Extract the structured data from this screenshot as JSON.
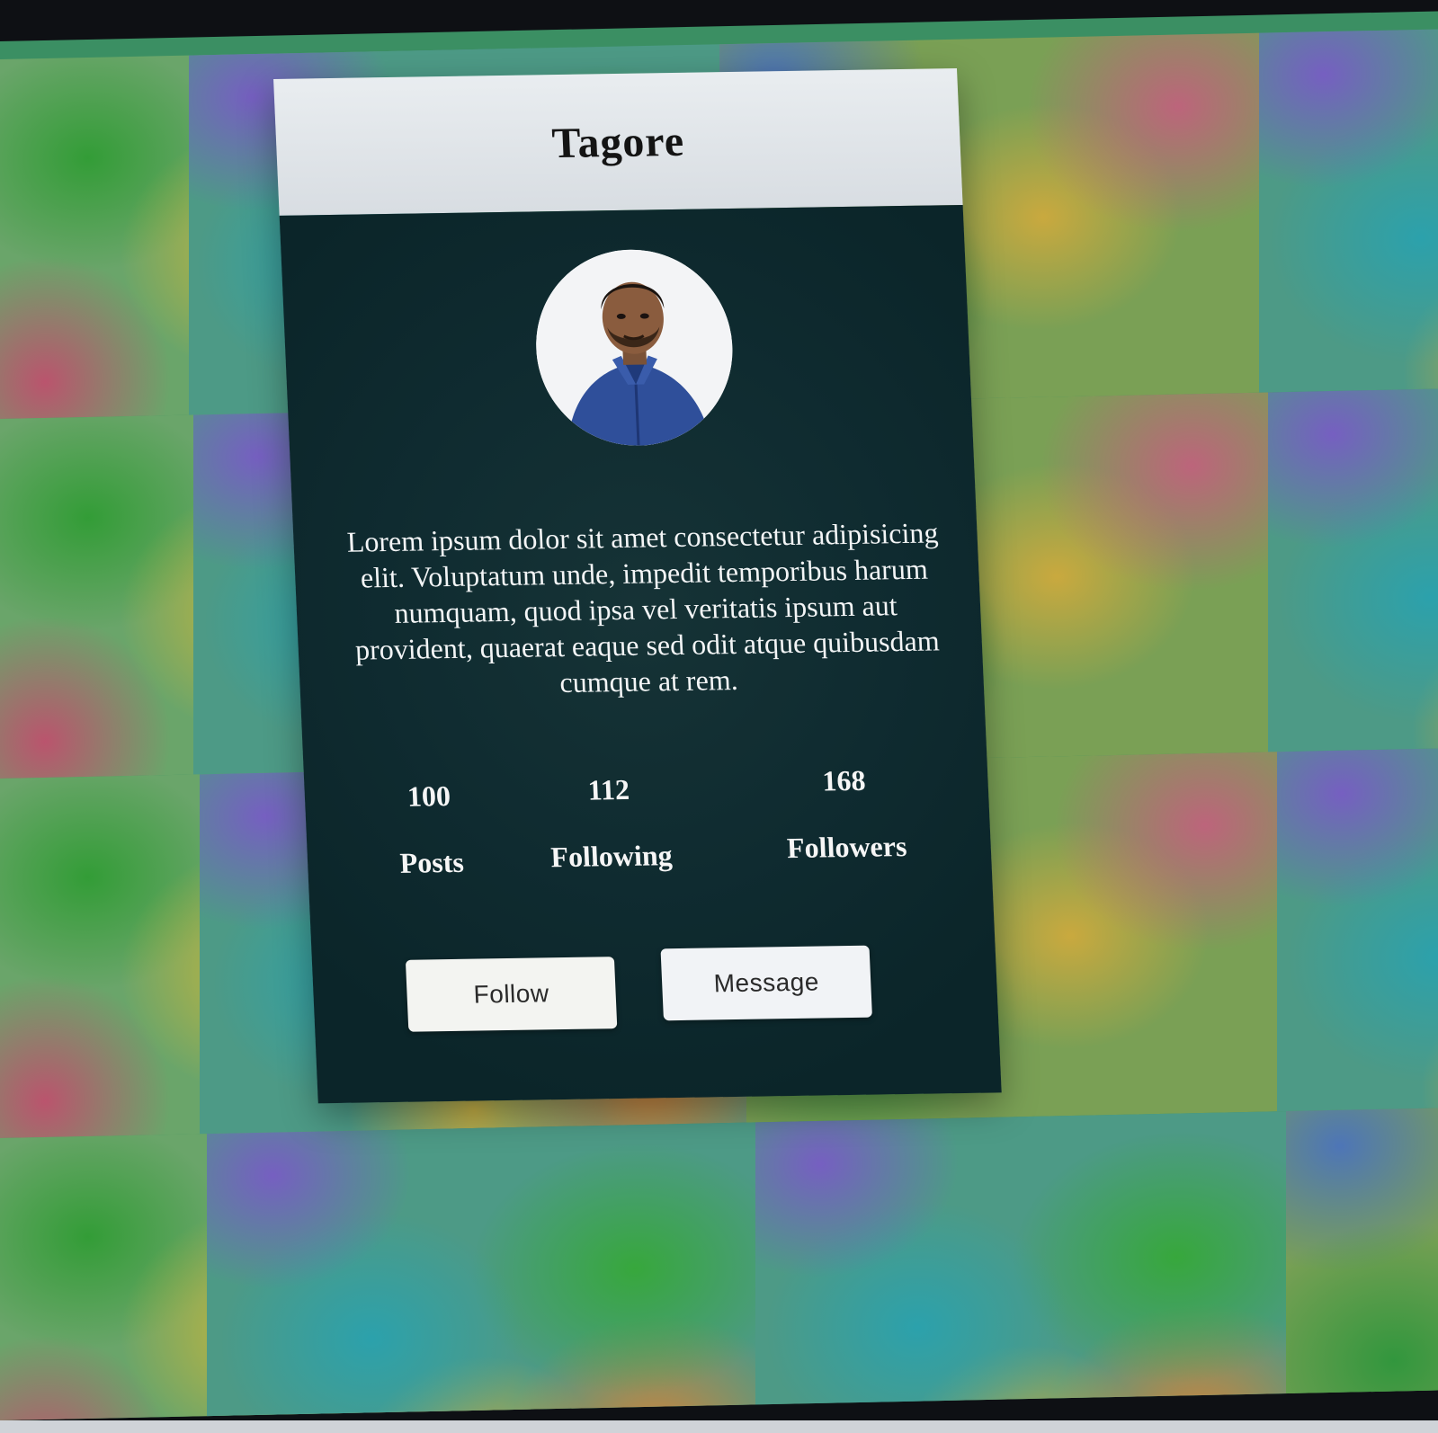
{
  "profile": {
    "name": "Tagore",
    "avatar_icon": "person-photo",
    "bio": "Lorem ipsum dolor sit amet consectetur adipisicing elit. Voluptatum unde, impedit temporibus harum numquam, quod ipsa vel veritatis ipsum aut provident, quaerat eaque sed odit atque quibusdam cumque at rem.",
    "stats": [
      {
        "value": "100",
        "label": "Posts"
      },
      {
        "value": "112",
        "label": "Following"
      },
      {
        "value": "168",
        "label": "Followers"
      }
    ],
    "buttons": {
      "follow_label": "Follow",
      "message_label": "Message"
    }
  },
  "colors": {
    "card_header": "#dde1e5",
    "card_body": "#0f2b30",
    "text_light": "#f3f5f6",
    "button_bg": "#f3f4f1"
  }
}
